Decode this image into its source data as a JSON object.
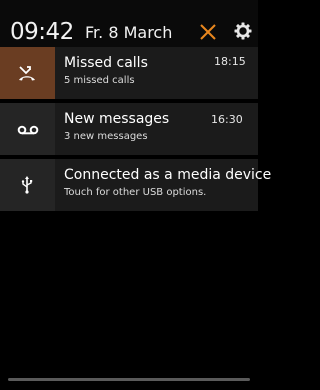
{
  "status_header": {
    "time": "09:42",
    "date": "Fr. 8 March",
    "clear_icon": "close-icon",
    "settings_icon": "gear-icon",
    "accent_color": "#e8871e"
  },
  "notifications": [
    {
      "icon": "missed-call-icon",
      "title": "Missed calls",
      "subtitle": "5 missed calls",
      "time": "18:15",
      "icon_bg": "#6a3d22"
    },
    {
      "icon": "voicemail-icon",
      "title": "New messages",
      "subtitle": "3 new messages",
      "time": "16:30"
    },
    {
      "icon": "usb-icon",
      "title": "Connected as a media device",
      "subtitle": "Touch for other USB options."
    }
  ]
}
